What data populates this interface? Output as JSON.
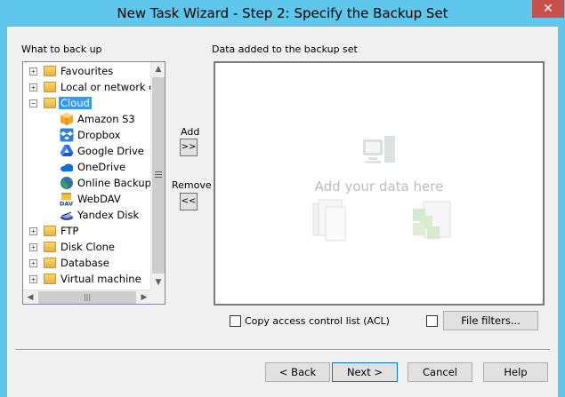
{
  "window": {
    "title": "New Task Wizard - Step 2: Specify the Backup Set",
    "close_glyph": "✕"
  },
  "left_panel": {
    "label": "What to back up"
  },
  "right_panel": {
    "label": "Data added to the backup set",
    "hint": "Add your data here"
  },
  "tree": {
    "items": [
      {
        "label": "Favourites",
        "expander": "+",
        "icon": "folder-icon"
      },
      {
        "label": "Local or network drives",
        "expander": "+",
        "icon": "folder-icon"
      },
      {
        "label": "Cloud",
        "expander": "−",
        "icon": "folder-icon",
        "selected": true
      },
      {
        "label": "Amazon S3",
        "icon": "amazon-s3-icon"
      },
      {
        "label": "Dropbox",
        "icon": "dropbox-icon"
      },
      {
        "label": "Google Drive",
        "icon": "google-drive-icon"
      },
      {
        "label": "OneDrive",
        "icon": "onedrive-icon"
      },
      {
        "label": "Online Backup",
        "icon": "globe-icon"
      },
      {
        "label": "WebDAV",
        "icon": "webdav-icon"
      },
      {
        "label": "Yandex Disk",
        "icon": "yandex-disk-icon"
      },
      {
        "label": "FTP",
        "expander": "+",
        "icon": "folder-icon"
      },
      {
        "label": "Disk Clone",
        "expander": "+",
        "icon": "folder-icon"
      },
      {
        "label": "Database",
        "expander": "+",
        "icon": "folder-icon"
      },
      {
        "label": "Virtual machine",
        "expander": "+",
        "icon": "folder-icon"
      }
    ]
  },
  "controls": {
    "add_label": "Add",
    "add_glyph": ">>",
    "remove_label": "Remove",
    "remove_glyph": "<<",
    "acl_label": "Copy access control list (ACL)",
    "file_filters": "File filters..."
  },
  "footer": {
    "back": "< Back",
    "next": "Next >",
    "cancel": "Cancel",
    "help": "Help"
  },
  "colors": {
    "title_bar": "#5fc6ec",
    "selection": "#3399ff",
    "close": "#c7504a"
  }
}
